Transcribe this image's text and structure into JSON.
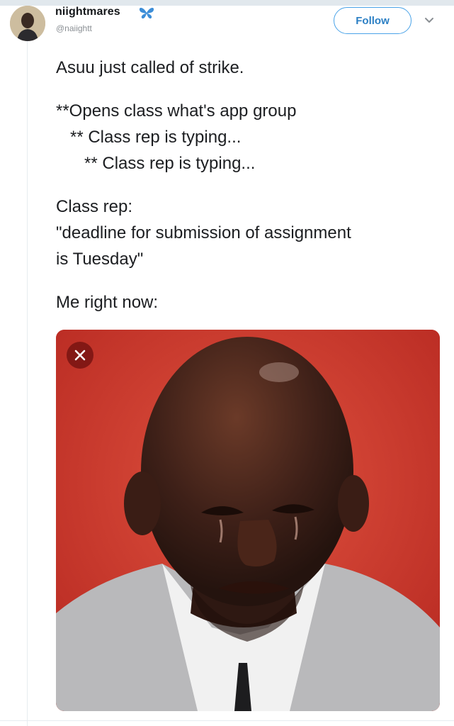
{
  "tweet": {
    "display_name": "niightmares",
    "handle": "@naiightt",
    "badge_icon": "butterfly-icon",
    "follow_label": "Follow",
    "more_icon": "chevron-down-icon",
    "lines": [
      "Asuu just called of strike.",
      "",
      "**Opens class what's app group",
      "   ** Class rep is typing...",
      "      ** Class rep is typing...",
      "",
      "Class rep:",
      "\"deadline for submission of assignment",
      "is Tuesday\"",
      "",
      "Me right now:"
    ]
  },
  "media": {
    "close_icon": "close-icon",
    "background_color": "#d23a2e"
  },
  "colors": {
    "accent": "#1da1f2",
    "text": "#14171a",
    "muted": "#8a8f94"
  }
}
